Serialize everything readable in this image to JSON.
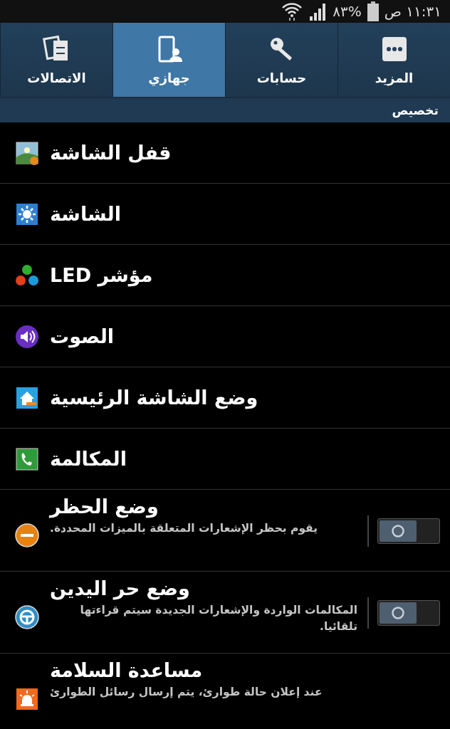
{
  "status_bar": {
    "time": "١١:٣١ ص",
    "battery": "٨٣%"
  },
  "tabs": [
    {
      "label": "المزيد",
      "selected": false
    },
    {
      "label": "حسابات",
      "selected": false
    },
    {
      "label": "جهازي",
      "selected": true
    },
    {
      "label": "الاتصالات",
      "selected": false
    }
  ],
  "section": {
    "title": "تخصيص"
  },
  "items": [
    {
      "kind": "link",
      "title": "قفل الشاشة"
    },
    {
      "kind": "link",
      "title": "الشاشة"
    },
    {
      "kind": "link",
      "title": "مؤشر LED"
    },
    {
      "kind": "link",
      "title": "الصوت"
    },
    {
      "kind": "link",
      "title": "وضع الشاشة الرئيسية"
    },
    {
      "kind": "link",
      "title": "المكالمة"
    },
    {
      "kind": "toggle",
      "title": "وضع الحظر",
      "subtitle": "يقوم بحظر الإشعارات المتعلقة بالميزات المحددة.",
      "on": false
    },
    {
      "kind": "toggle",
      "title": "وضع حر اليدين",
      "subtitle": "المكالمات الواردة والإشعارات الجديدة سيتم قراءتها تلقائيا.",
      "on": false
    },
    {
      "kind": "link",
      "title": "مساعدة السلامة",
      "subtitle": "عند إعلان حالة طوارئ، يتم إرسال رسائل الطوارئ"
    }
  ]
}
